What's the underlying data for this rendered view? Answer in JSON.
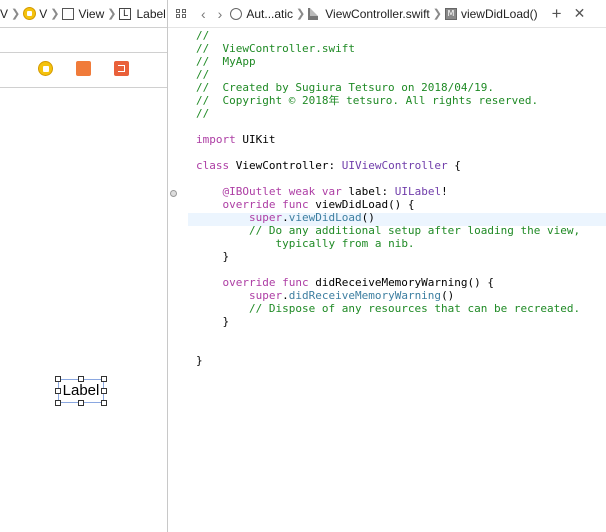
{
  "left_jumpbar": {
    "seg1": "V",
    "seg2": "V",
    "seg3": "View",
    "seg4": "Label"
  },
  "right_jumpbar": {
    "related_label": "Aut...atic",
    "file_label": "ViewController.swift",
    "method_label": "viewDidLoad()",
    "add_label": "+"
  },
  "canvas": {
    "label_text": "Label"
  },
  "code_lines": [
    [
      [
        "com",
        "//"
      ]
    ],
    [
      [
        "com",
        "//  ViewController.swift"
      ]
    ],
    [
      [
        "com",
        "//  MyApp"
      ]
    ],
    [
      [
        "com",
        "//"
      ]
    ],
    [
      [
        "com",
        "//  Created by Sugiura Tetsuro on 2018/04/19."
      ]
    ],
    [
      [
        "com",
        "//  Copyright © 2018年 tetsuro. All rights reserved."
      ]
    ],
    [
      [
        "com",
        "//"
      ]
    ],
    [],
    [
      [
        "kw",
        "import"
      ],
      [
        "plain",
        " UIKit"
      ]
    ],
    [],
    [
      [
        "kw",
        "class"
      ],
      [
        "plain",
        " ViewController: "
      ],
      [
        "type",
        "UIViewController"
      ],
      [
        "plain",
        " {"
      ]
    ],
    [],
    [
      [
        "plain",
        "    "
      ],
      [
        "attr",
        "@IBOutlet"
      ],
      [
        "plain",
        " "
      ],
      [
        "kw",
        "weak var"
      ],
      [
        "plain",
        " label: "
      ],
      [
        "type",
        "UILabel"
      ],
      [
        "plain",
        "!"
      ]
    ],
    [
      [
        "plain",
        "    "
      ],
      [
        "kw",
        "override func"
      ],
      [
        "plain",
        " viewDidLoad() {"
      ]
    ],
    [
      [
        "plain",
        "        "
      ],
      [
        "kw",
        "super"
      ],
      [
        "plain",
        "."
      ],
      [
        "call",
        "viewDidLoad"
      ],
      [
        "plain",
        "()"
      ]
    ],
    [
      [
        "plain",
        "        "
      ],
      [
        "com",
        "// Do any additional setup after loading the view,"
      ]
    ],
    [
      [
        "plain",
        "            "
      ],
      [
        "com",
        "typically from a nib."
      ]
    ],
    [
      [
        "plain",
        "    }"
      ]
    ],
    [],
    [
      [
        "plain",
        "    "
      ],
      [
        "kw",
        "override func"
      ],
      [
        "plain",
        " didReceiveMemoryWarning() {"
      ]
    ],
    [
      [
        "plain",
        "        "
      ],
      [
        "kw",
        "super"
      ],
      [
        "plain",
        "."
      ],
      [
        "call",
        "didReceiveMemoryWarning"
      ],
      [
        "plain",
        "()"
      ]
    ],
    [
      [
        "plain",
        "        "
      ],
      [
        "com",
        "// Dispose of any resources that can be recreated."
      ]
    ],
    [
      [
        "plain",
        "    }"
      ]
    ],
    [],
    [],
    [
      [
        "plain",
        "}"
      ]
    ]
  ]
}
